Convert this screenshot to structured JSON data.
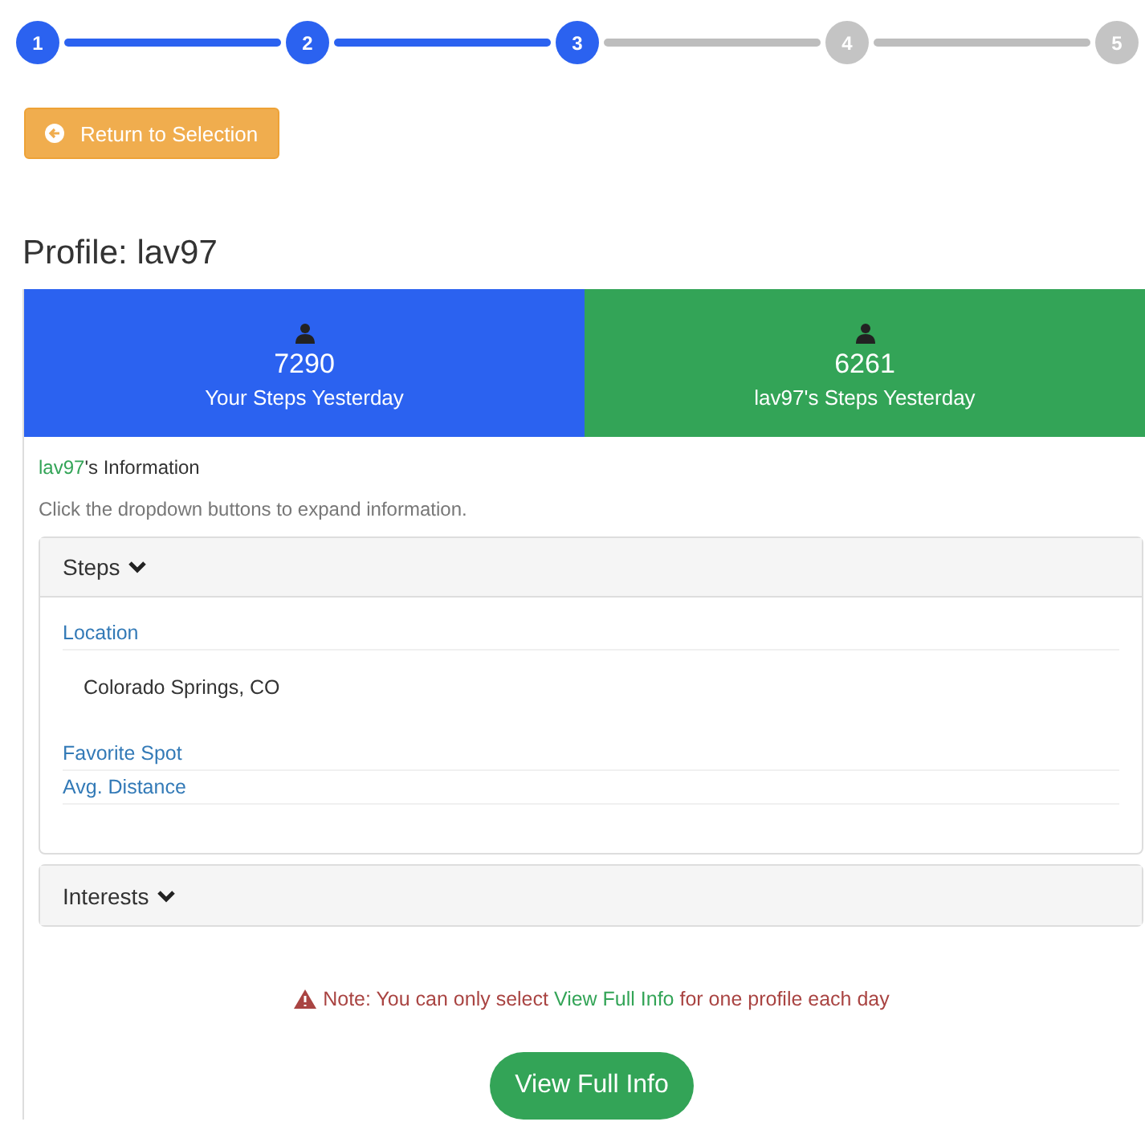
{
  "stepper": [
    {
      "label": "1",
      "done": true
    },
    {
      "label": "2",
      "done": true
    },
    {
      "label": "3",
      "done": true
    },
    {
      "label": "4",
      "done": false
    },
    {
      "label": "5",
      "done": false
    }
  ],
  "back_button": {
    "label": "Return to Selection"
  },
  "title": "Profile: lav97",
  "stats": [
    {
      "value": "7290",
      "label": "Your Steps Yesterday",
      "color": "#2b62f0"
    },
    {
      "value": "6261",
      "label": "lav97's Steps Yesterday",
      "color": "#33a457"
    }
  ],
  "info": {
    "name": "lav97",
    "heading_suffix": "'s Information",
    "hint": "Click the dropdown buttons to expand information."
  },
  "sections": [
    {
      "title": "Steps",
      "expanded": true,
      "items": [
        {
          "label": "Location",
          "value": "Colorado Springs, CO"
        },
        {
          "label": "Favorite Spot"
        },
        {
          "label": "Avg. Distance"
        }
      ]
    },
    {
      "title": "Interests",
      "expanded": false
    }
  ],
  "note": {
    "before": "Note: You can only select ",
    "link": "View Full Info",
    "after": " for one profile each day"
  },
  "action_button": {
    "label": "View Full Info"
  }
}
